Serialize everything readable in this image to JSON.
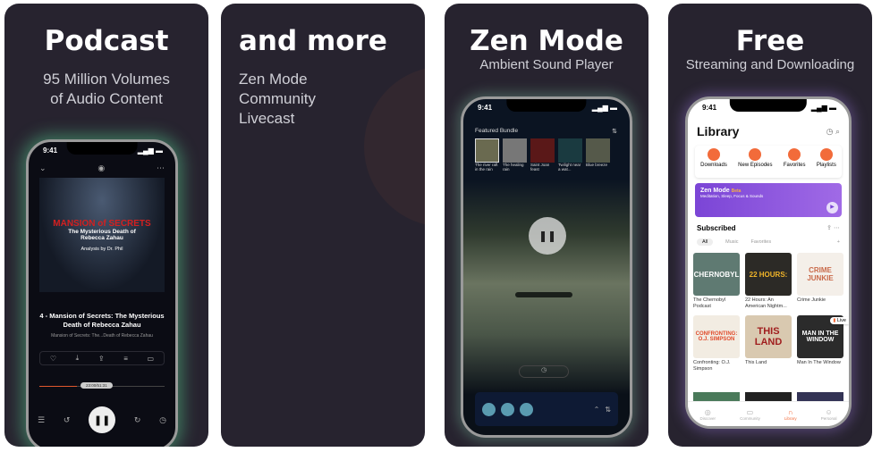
{
  "panels": [
    {
      "title": "Podcast",
      "subtitle": [
        "95 Million Volumes",
        "of Audio Content"
      ]
    },
    {
      "title": "and more",
      "subtitle": [
        "Zen Mode",
        "Community",
        "Livecast"
      ]
    },
    {
      "title": "Zen Mode",
      "subtitle": [
        "Ambient Sound Player"
      ]
    },
    {
      "title": "Free",
      "subtitle": [
        "Streaming and Downloading"
      ]
    }
  ],
  "status_time": "9:41",
  "player": {
    "cover_title": "MANSION of SECRETS",
    "cover_subtitle": "The Mysterious Death of Rebecca Zahau",
    "cover_credit": "Analysis by Dr. Phil",
    "episode_title": "4 - Mansion of Secrets: The Mysterious Death of Rebecca Zahau",
    "show_line": "Mansion of Secrets: The...Death of Rebecca Zahau",
    "time": "23:00/51:31",
    "progress": 0.3
  },
  "zen": {
    "featured_label": "Featured Bundle",
    "bundles": [
      "The river raft in the rain",
      "The healing rain",
      "Saint Joan feast",
      "Twilight near a wat...",
      "Blue breeze"
    ]
  },
  "library": {
    "title": "Library",
    "shortcuts": [
      "Downloads",
      "New Episodes",
      "Favorites",
      "Playlists"
    ],
    "zen_banner": {
      "title": "Zen Mode",
      "badge": "Beta",
      "desc": "Meditation, Sleep, Focus & Sounds"
    },
    "subscribed": "Subscribed",
    "filters": [
      "All",
      "Music",
      "Favorites"
    ],
    "podcasts": [
      {
        "name": "The Chernobyl Podcast",
        "cover": "CHERNOBYL",
        "bg": "#5f7a72"
      },
      {
        "name": "22 Hours: An American Nightm...",
        "cover": "22 HOURS:",
        "bg": "#2c2a26"
      },
      {
        "name": "Crime Junkie",
        "cover": "CRIME JUNKIE",
        "bg": "#f4efe9"
      },
      {
        "name": "Confronting: O.J. Simpson",
        "cover": "CONFRONTING: O.J. SIMPSON",
        "bg": "#f2ece2"
      },
      {
        "name": "This Land",
        "cover": "THIS LAND",
        "bg": "#d9c9b0"
      },
      {
        "name": "Man In The Window",
        "cover": "MAN IN THE WINDOW",
        "bg": "#2b2b2b"
      }
    ],
    "live_badge": "Live",
    "tabs": [
      "Discover",
      "Community",
      "Library",
      "Personal"
    ],
    "accent": "#f26b3a"
  }
}
